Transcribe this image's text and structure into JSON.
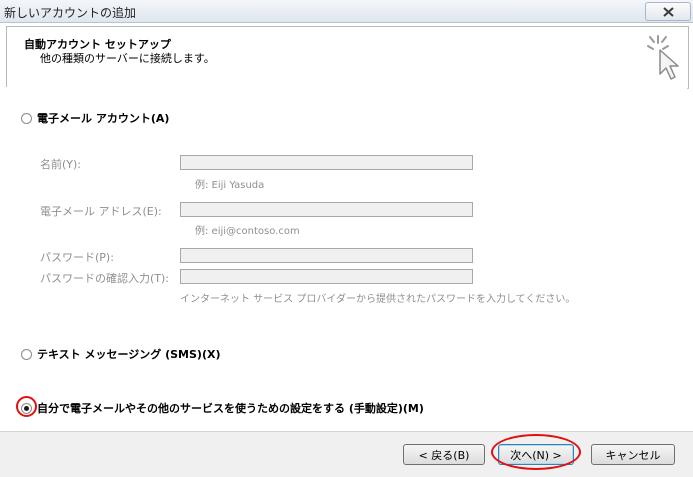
{
  "window": {
    "title": "新しいアカウントの追加"
  },
  "header": {
    "title": "自動アカウント セットアップ",
    "subtitle": "他の種類のサーバーに接続します。"
  },
  "options": {
    "email_account": {
      "label": "電子メール アカウント(A)",
      "selected": false
    },
    "sms": {
      "label": "テキスト メッセージング (SMS)(X)",
      "selected": false
    },
    "manual": {
      "label": "自分で電子メールやその他のサービスを使うための設定をする (手動設定)(M)",
      "selected": true
    }
  },
  "form": {
    "name_label": "名前(Y):",
    "name_value": "",
    "name_hint": "例: Eiji Yasuda",
    "email_label": "電子メール アドレス(E):",
    "email_value": "",
    "email_hint": "例: eiji@contoso.com",
    "password_label": "パスワード(P):",
    "password_value": "",
    "confirm_label": "パスワードの確認入力(T):",
    "confirm_value": "",
    "password_hint": "インターネット サービス プロバイダーから提供されたパスワードを入力してください。"
  },
  "buttons": {
    "back": "< 戻る(B)",
    "next": "次へ(N) >",
    "cancel": "キャンセル"
  },
  "colors": {
    "highlight": "#e01010",
    "footer": "#f0f0f0"
  }
}
